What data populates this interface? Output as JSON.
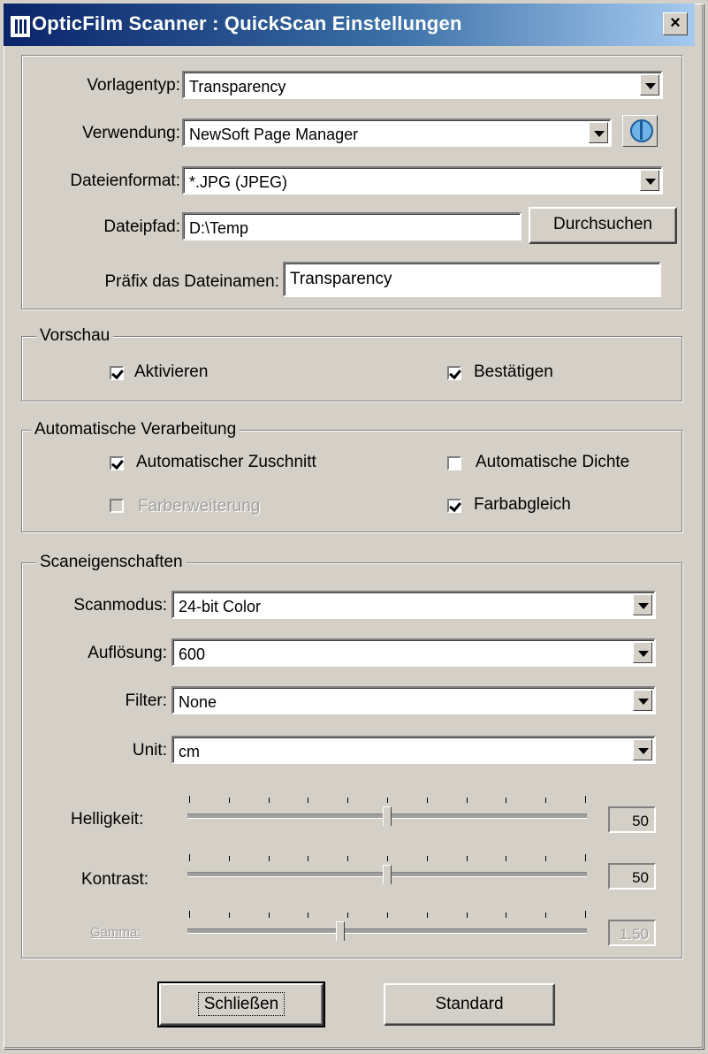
{
  "window": {
    "title": "OpticFilm Scanner : QuickScan Einstellungen",
    "close_glyph": "×"
  },
  "general": {
    "vorlagentyp_label": "Vorlagentyp:",
    "vorlagentyp_value": "Transparency",
    "verwendung_label": "Verwendung:",
    "verwendung_value": "NewSoft Page Manager",
    "dateiformat_label": "Dateienformat:",
    "dateiformat_value": "*.JPG (JPEG)",
    "dateipfad_label": "Dateipfad:",
    "dateipfad_value": "D:\\Temp",
    "browse_label": "Durchsuchen",
    "praefix_label": "Präfix das Dateinamen:",
    "praefix_value": "Transparency"
  },
  "vorschau": {
    "legend": "Vorschau",
    "aktivieren": {
      "label": "Aktivieren",
      "checked": true
    },
    "bestaetigen": {
      "label": "Bestätigen",
      "checked": true
    }
  },
  "auto": {
    "legend": "Automatische Verarbeitung",
    "zuschnitt": {
      "label": "Automatischer Zuschnitt",
      "checked": true
    },
    "dichte": {
      "label": "Automatische Dichte",
      "checked": false
    },
    "farberweiterung": {
      "label": "Farberweiterung",
      "checked": false,
      "disabled": true
    },
    "farbabgleich": {
      "label": "Farbabgleich",
      "checked": true
    }
  },
  "scan": {
    "legend": "Scaneigenschaften",
    "scanmodus_label": "Scanmodus:",
    "scanmodus_value": "24-bit Color",
    "aufloesung_label": "Auflösung:",
    "aufloesung_value": "600",
    "filter_label": "Filter:",
    "filter_value": "None",
    "unit_label": "Unit:",
    "unit_value": "cm",
    "helligkeit_label": "Helligkeit:",
    "helligkeit_value": "50",
    "kontrast_label": "Kontrast:",
    "kontrast_value": "50",
    "gamma_label": "Gamma:",
    "gamma_value": "1.50",
    "helligkeit_level": 0.5,
    "kontrast_level": 0.5,
    "gamma_level": 0.38
  },
  "buttons": {
    "close": "Schließen",
    "standard": "Standard"
  }
}
